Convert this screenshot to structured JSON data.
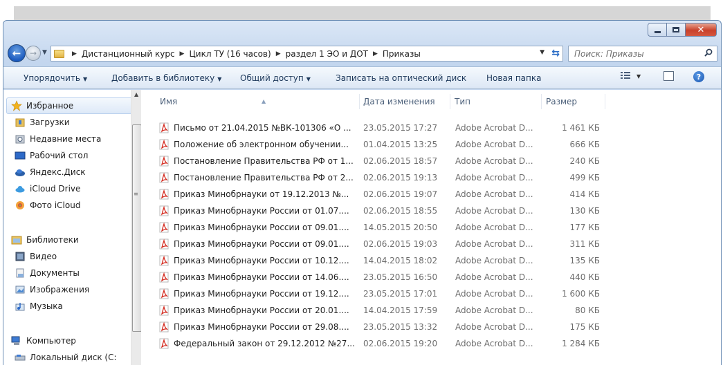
{
  "window": {
    "breadcrumb": [
      "Дистанционный курс",
      "Цикл ТУ (16 часов)",
      "раздел 1 ЭО и ДОТ",
      "Приказы"
    ],
    "search_placeholder": "Поиск: Приказы"
  },
  "toolbar": {
    "organize": "Упорядочить",
    "add_to_library": "Добавить в библиотеку",
    "share": "Общий доступ",
    "burn": "Записать на оптический диск",
    "new_folder": "Новая папка"
  },
  "sidebar": {
    "favorites": "Избранное",
    "favorites_items": [
      "Загрузки",
      "Недавние места",
      "Рабочий стол",
      "Яндекс.Диск",
      "iCloud Drive",
      "Фото iCloud"
    ],
    "libraries": "Библиотеки",
    "libraries_items": [
      "Видео",
      "Документы",
      "Изображения",
      "Музыка"
    ],
    "computer": "Компьютер",
    "computer_items": [
      "Локальный диск (C:"
    ]
  },
  "columns": {
    "name": "Имя",
    "date": "Дата изменения",
    "type": "Тип",
    "size": "Размер"
  },
  "files": [
    {
      "name": "Письмо от 21.04.2015 №ВК-101306 «О ...",
      "date": "23.05.2015 17:27",
      "type": "Adobe Acrobat D...",
      "size": "1 461 КБ"
    },
    {
      "name": "Положение об электронном обучении...",
      "date": "01.04.2015 13:25",
      "type": "Adobe Acrobat D...",
      "size": "666 КБ"
    },
    {
      "name": "Постановление Правительства РФ от 1...",
      "date": "02.06.2015 18:57",
      "type": "Adobe Acrobat D...",
      "size": "240 КБ"
    },
    {
      "name": "Постановление Правительства РФ от 2...",
      "date": "02.06.2015 19:13",
      "type": "Adobe Acrobat D...",
      "size": "499 КБ"
    },
    {
      "name": "Приказ Минобрнауки от 19.12.2013 №...",
      "date": "02.06.2015 19:07",
      "type": "Adobe Acrobat D...",
      "size": "414 КБ"
    },
    {
      "name": "Приказ Минобрнауки России от 01.07....",
      "date": "02.06.2015 18:55",
      "type": "Adobe Acrobat D...",
      "size": "130 КБ"
    },
    {
      "name": "Приказ Минобрнауки России от 09.01....",
      "date": "14.05.2015 20:50",
      "type": "Adobe Acrobat D...",
      "size": "177 КБ"
    },
    {
      "name": "Приказ Минобрнауки России от 09.01....",
      "date": "02.06.2015 19:03",
      "type": "Adobe Acrobat D...",
      "size": "311 КБ"
    },
    {
      "name": "Приказ Минобрнауки России от 10.12....",
      "date": "14.04.2015 18:02",
      "type": "Adobe Acrobat D...",
      "size": "135 КБ"
    },
    {
      "name": "Приказ Минобрнауки России от 14.06....",
      "date": "23.05.2015 16:50",
      "type": "Adobe Acrobat D...",
      "size": "440 КБ"
    },
    {
      "name": "Приказ Минобрнауки России от 19.12....",
      "date": "23.05.2015 17:01",
      "type": "Adobe Acrobat D...",
      "size": "1 600 КБ"
    },
    {
      "name": "Приказ Минобрнауки России от 20.01....",
      "date": "14.04.2015 17:59",
      "type": "Adobe Acrobat D...",
      "size": "80 КБ"
    },
    {
      "name": "Приказ Минобрнауки России от 29.08....",
      "date": "23.05.2015 13:32",
      "type": "Adobe Acrobat D...",
      "size": "175 КБ"
    },
    {
      "name": "Федеральный закон от 29.12.2012 №27...",
      "date": "02.06.2015 19:20",
      "type": "Adobe Acrobat D...",
      "size": "1 284 КБ"
    }
  ],
  "icons": {
    "back": "back-arrow-icon",
    "forward": "forward-arrow-icon",
    "refresh": "refresh-icon",
    "search": "search-icon",
    "file": "pdf-file-icon",
    "help": "help-icon"
  },
  "colors": {
    "titlebar": "#c3d6ee",
    "toolbar_text": "#1e395b",
    "close_button": "#c9422c"
  }
}
